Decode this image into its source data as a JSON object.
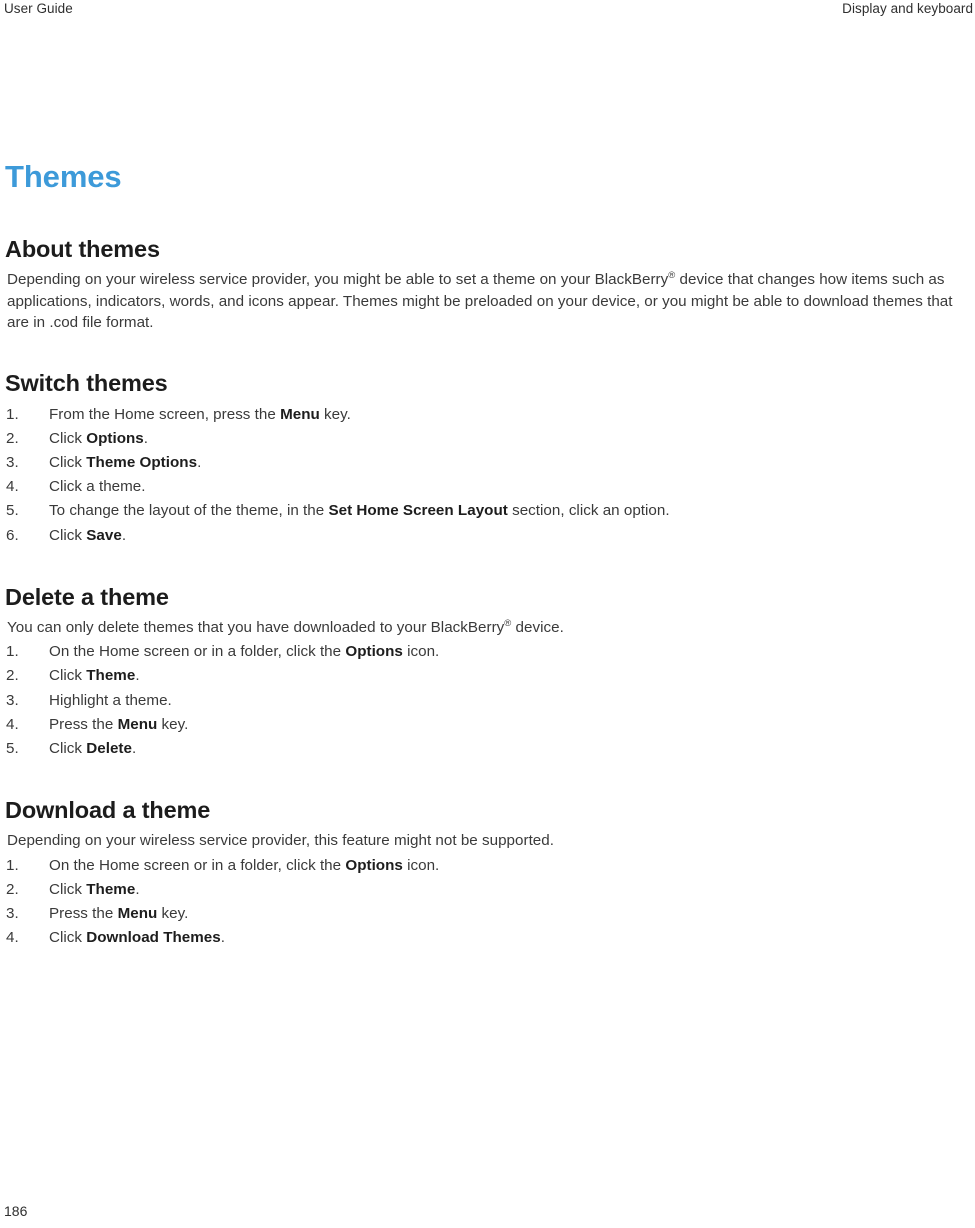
{
  "header": {
    "left": "User Guide",
    "right": "Display and keyboard"
  },
  "chapter": {
    "title": "Themes"
  },
  "sections": [
    {
      "heading": "About themes",
      "intro_parts": [
        {
          "t": "Depending on your wireless service provider, you might be able to set a theme on your BlackBerry",
          "bold": false
        },
        {
          "t": "®",
          "sup": true
        },
        {
          "t": " device that changes how items such as applications, indicators, words, and icons appear. Themes might be preloaded on your device, or you might be able to download themes that are in .cod file format.",
          "bold": false
        }
      ],
      "steps": []
    },
    {
      "heading": "Switch themes",
      "intro_parts": [],
      "steps": [
        [
          {
            "t": "From the Home screen, press the "
          },
          {
            "t": "Menu",
            "bold": true
          },
          {
            "t": " key."
          }
        ],
        [
          {
            "t": "Click "
          },
          {
            "t": "Options",
            "bold": true
          },
          {
            "t": "."
          }
        ],
        [
          {
            "t": "Click "
          },
          {
            "t": "Theme Options",
            "bold": true
          },
          {
            "t": "."
          }
        ],
        [
          {
            "t": "Click a theme."
          }
        ],
        [
          {
            "t": "To change the layout of the theme, in the "
          },
          {
            "t": "Set Home Screen Layout",
            "bold": true
          },
          {
            "t": " section, click an option."
          }
        ],
        [
          {
            "t": "Click "
          },
          {
            "t": "Save",
            "bold": true
          },
          {
            "t": "."
          }
        ]
      ]
    },
    {
      "heading": "Delete a theme",
      "intro_parts": [
        {
          "t": "You can only delete themes that you have downloaded to your BlackBerry"
        },
        {
          "t": "®",
          "sup": true
        },
        {
          "t": " device."
        }
      ],
      "steps": [
        [
          {
            "t": "On the Home screen or in a folder, click the "
          },
          {
            "t": "Options",
            "bold": true
          },
          {
            "t": " icon."
          }
        ],
        [
          {
            "t": "Click "
          },
          {
            "t": "Theme",
            "bold": true
          },
          {
            "t": "."
          }
        ],
        [
          {
            "t": "Highlight a theme."
          }
        ],
        [
          {
            "t": "Press the "
          },
          {
            "t": "Menu",
            "bold": true
          },
          {
            "t": " key."
          }
        ],
        [
          {
            "t": "Click "
          },
          {
            "t": "Delete",
            "bold": true
          },
          {
            "t": "."
          }
        ]
      ]
    },
    {
      "heading": "Download a theme",
      "intro_parts": [
        {
          "t": "Depending on your wireless service provider, this feature might not be supported."
        }
      ],
      "steps": [
        [
          {
            "t": "On the Home screen or in a folder, click the "
          },
          {
            "t": "Options",
            "bold": true
          },
          {
            "t": " icon."
          }
        ],
        [
          {
            "t": "Click "
          },
          {
            "t": "Theme",
            "bold": true
          },
          {
            "t": "."
          }
        ],
        [
          {
            "t": "Press the "
          },
          {
            "t": "Menu",
            "bold": true
          },
          {
            "t": " key."
          }
        ],
        [
          {
            "t": "Click "
          },
          {
            "t": "Download Themes",
            "bold": true
          },
          {
            "t": "."
          }
        ]
      ]
    }
  ],
  "footer": {
    "page_number": "186"
  },
  "colors": {
    "chapter_title": "#3d9ad9",
    "heading": "#1c1c1c",
    "body": "#3a3a3a"
  }
}
